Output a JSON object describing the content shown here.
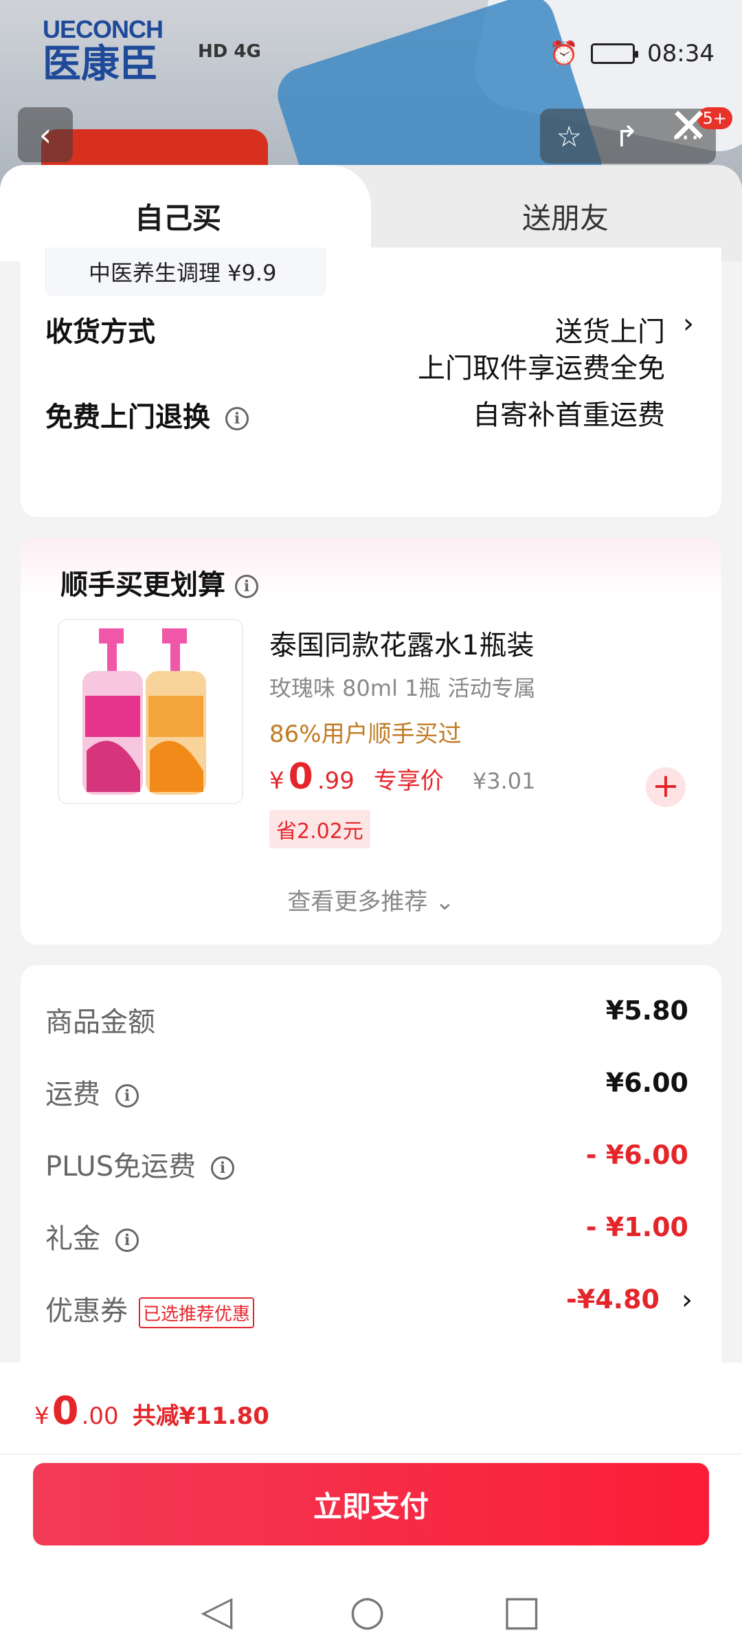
{
  "background": {
    "brand_en": "UECONCH",
    "brand_zh": "医康臣",
    "network": "HD 4G",
    "time": "08:34",
    "badge": "5+"
  },
  "tabs": {
    "self": "自己买",
    "friend": "送朋友"
  },
  "delivery_card": {
    "chip": "中医养生调理 ¥9.9",
    "shipping_label": "收货方式",
    "shipping_value": "送货上门",
    "return_label": "免费上门退换",
    "return_line1": "上门取件享运费全免",
    "return_line2": "自寄补首重运费"
  },
  "upsell": {
    "title": "顺手买更划算",
    "product_name": "泰国同款花露水1瓶装",
    "product_spec": "玫瑰味 80ml 1瓶 活动专属",
    "product_note": "86%用户顺手买过",
    "price_yen": "¥",
    "price_int": "0",
    "price_dec": ".99",
    "exclusive": "专享价",
    "original_price": "¥3.01",
    "save_tag": "省2.02元",
    "more": "查看更多推荐 ⌄"
  },
  "fees": [
    {
      "label": "商品金额",
      "value": "¥5.80",
      "red": false,
      "info": false
    },
    {
      "label": "运费",
      "value": "¥6.00",
      "red": false,
      "info": true
    },
    {
      "label": "PLUS免运费",
      "value": "- ¥6.00",
      "red": true,
      "info": true
    },
    {
      "label": "礼金",
      "value": "- ¥1.00",
      "red": true,
      "info": true
    },
    {
      "label": "优惠券",
      "value": "-¥4.80",
      "red": true,
      "info": false,
      "tag": "已选推荐优惠"
    }
  ],
  "bottom": {
    "yen": "¥",
    "int": "0",
    "dec": ".00",
    "saved": "共减¥11.80",
    "pay": "立即支付"
  },
  "colors": {
    "accent": "#e4262b",
    "pay_gradient_start": "#f23b57",
    "pay_gradient_end": "#fb1d37"
  }
}
